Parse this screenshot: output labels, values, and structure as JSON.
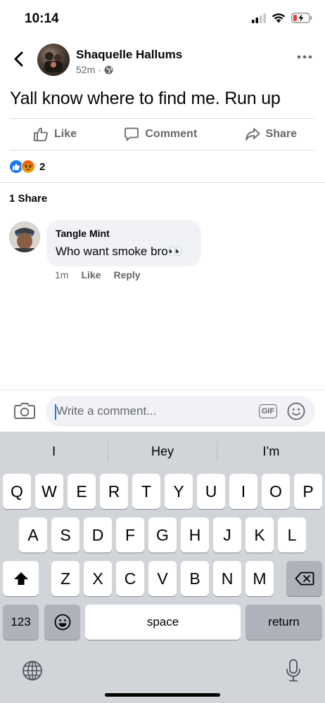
{
  "status_bar": {
    "time": "10:14"
  },
  "post": {
    "author": "Shaquelle Hallums",
    "time_ago": "52m",
    "separator": "·",
    "text": "Yall know where to find me. Run up",
    "actions": {
      "like": "Like",
      "comment": "Comment",
      "share": "Share"
    },
    "reaction_count": "2",
    "shares_label": "1 Share"
  },
  "comment": {
    "author": "Tangle Mint",
    "text": "Who want smoke bro👀",
    "time": "1m",
    "like": "Like",
    "reply": "Reply"
  },
  "composer": {
    "placeholder": "Write a comment...",
    "gif_label": "GIF"
  },
  "keyboard": {
    "suggestions": [
      "I",
      "Hey",
      "I’m"
    ],
    "row1": [
      "Q",
      "W",
      "E",
      "R",
      "T",
      "Y",
      "U",
      "I",
      "O",
      "P"
    ],
    "row2": [
      "A",
      "S",
      "D",
      "F",
      "G",
      "H",
      "J",
      "K",
      "L"
    ],
    "row3": [
      "Z",
      "X",
      "C",
      "V",
      "B",
      "N",
      "M"
    ],
    "numbers_key": "123",
    "space_key": "space",
    "return_key": "return"
  },
  "colors": {
    "accent": "#1877f2",
    "like_blue": "#1877f2",
    "angry": "#e9710f",
    "battery_low": "#e0443b"
  }
}
